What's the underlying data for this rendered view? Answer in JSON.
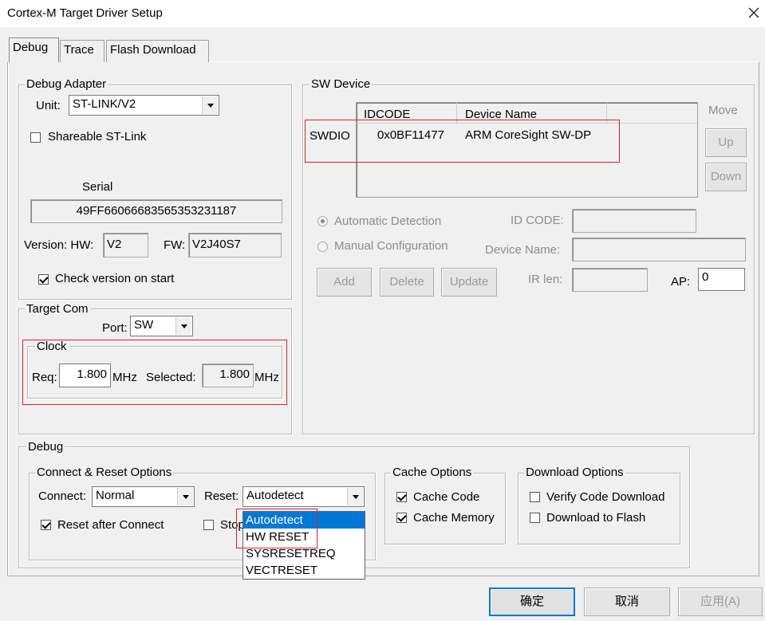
{
  "window": {
    "title": "Cortex-M Target Driver Setup"
  },
  "tabs": [
    {
      "label": "Debug",
      "active": true
    },
    {
      "label": "Trace",
      "active": false
    },
    {
      "label": "Flash Download",
      "active": false
    }
  ],
  "debug_adapter": {
    "legend": "Debug Adapter",
    "unit_label": "Unit:",
    "unit_value": "ST-LINK/V2",
    "shareable_label": "Shareable ST-Link",
    "shareable_checked": false,
    "serial_label": "Serial",
    "serial_value": "49FF66066683565353231187",
    "version_label": "Version: HW:",
    "hw_value": "V2",
    "fw_label": "FW:",
    "fw_value": "V2J40S7",
    "check_version_label": "Check version on start",
    "check_version_checked": true
  },
  "target_com": {
    "legend": "Target Com",
    "port_label": "Port:",
    "port_value": "SW",
    "clock_legend": "Clock",
    "req_label": "Req:",
    "req_value": "1.800",
    "req_unit": "MHz",
    "selected_label": "Selected:",
    "selected_value": "1.800",
    "selected_unit": "MHz"
  },
  "sw_device": {
    "legend": "SW Device",
    "move_label": "Move",
    "up_label": "Up",
    "down_label": "Down",
    "columns": [
      "IDCODE",
      "Device Name"
    ],
    "rows": [
      {
        "port": "SWDIO",
        "idcode": "0x0BF11477",
        "device_name": "ARM CoreSight SW-DP"
      }
    ],
    "auto_detect_label": "Automatic Detection",
    "manual_config_label": "Manual Configuration",
    "id_code_label": "ID CODE:",
    "device_name_label": "Device Name:",
    "ir_len_label": "IR len:",
    "ap_label": "AP:",
    "ap_value": "0",
    "add_label": "Add",
    "delete_label": "Delete",
    "update_label": "Update"
  },
  "debug_section": {
    "legend": "Debug",
    "connect_reset": {
      "legend": "Connect & Reset Options",
      "connect_label": "Connect:",
      "connect_value": "Normal",
      "reset_label": "Reset:",
      "reset_value": "Autodetect",
      "reset_after_connect_label": "Reset after Connect",
      "reset_after_connect_checked": true,
      "stop_label_partial": "Stop"
    },
    "cache_options": {
      "legend": "Cache Options",
      "cache_code_label": "Cache Code",
      "cache_code_checked": true,
      "cache_memory_label": "Cache Memory",
      "cache_memory_checked": true
    },
    "download_options": {
      "legend": "Download Options",
      "verify_label": "Verify Code Download",
      "verify_checked": false,
      "download_flash_label": "Download to Flash",
      "download_flash_checked": false
    }
  },
  "reset_dropdown": {
    "options": [
      "Autodetect",
      "HW RESET",
      "SYSRESETREQ",
      "VECTRESET"
    ],
    "selected": "Autodetect"
  },
  "footer": {
    "ok_label": "确定",
    "cancel_label": "取消",
    "apply_label": "应用(A)"
  },
  "colors": {
    "highlight": "#0078d7",
    "annotation": "#d9232e"
  }
}
